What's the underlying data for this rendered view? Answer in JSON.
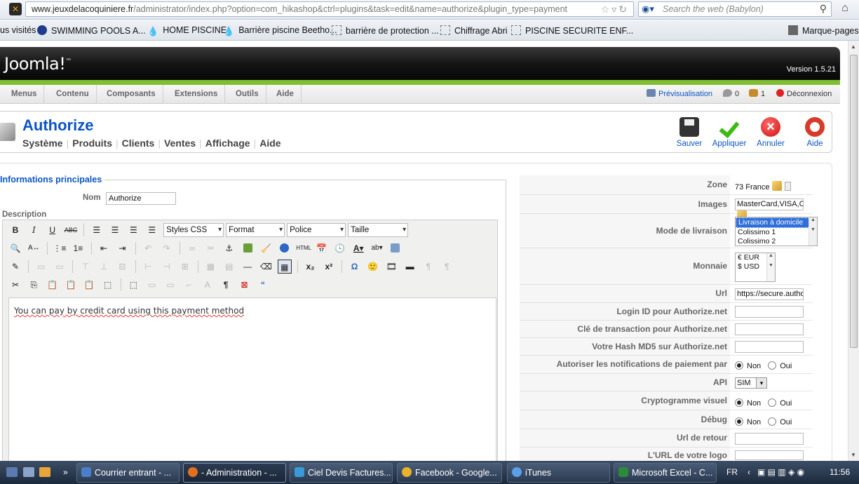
{
  "browser": {
    "url_domain": "www.jeuxdelacoquiniere.fr",
    "url_path": "/administrator/index.php?option=com_hikashop&ctrl=plugins&task=edit&name=authorize&plugin_type=payment",
    "search_placeholder": "Search the web (Babylon)",
    "bookmarks": [
      {
        "label": "us visités",
        "icon": "none"
      },
      {
        "label": "SWIMMING POOLS A...",
        "icon": "globe"
      },
      {
        "label": "HOME PISCINE",
        "icon": "drop"
      },
      {
        "label": "Barrière piscine Beetho...",
        "icon": "drop"
      },
      {
        "label": "barrière de protection ...",
        "icon": "empty"
      },
      {
        "label": "Chiffrage Abri",
        "icon": "empty"
      },
      {
        "label": "PISCINE SECURITE ENF...",
        "icon": "empty"
      }
    ],
    "bookmark_menu": "Marque-pages"
  },
  "joomla": {
    "logo": "Joomla!",
    "version": "Version 1.5.21",
    "menu": [
      "Menus",
      "Contenu",
      "Composants",
      "Extensions",
      "Outils",
      "Aide"
    ],
    "preview": "Prévisualisation",
    "messages_count": "0",
    "users_count": "1",
    "logout": "Déconnexion"
  },
  "page": {
    "title": "Authorize",
    "submenu": [
      "Système",
      "Produits",
      "Clients",
      "Ventes",
      "Affichage",
      "Aide"
    ],
    "toolbar": {
      "save": "Sauver",
      "apply": "Appliquer",
      "cancel": "Annuler",
      "help": "Aide"
    }
  },
  "main_info": {
    "legend": "Informations principales",
    "name_label": "Nom",
    "name_value": "Authorize",
    "description_label": "Description"
  },
  "editor": {
    "styles_css": "Styles CSS",
    "format": "Format",
    "font": "Police",
    "size": "Taille",
    "content": "You can pay by credit card using this payment method"
  },
  "params": {
    "zone_label": "Zone",
    "zone_value": "73 France",
    "images_label": "Images",
    "images_value": "MasterCard,VISA,Credit",
    "shipping_label": "Mode de livraison",
    "shipping_options": [
      "Livraison à domicile",
      "Colissimo 1",
      "Colissimo 2"
    ],
    "currency_label": "Monnaie",
    "currency_options": [
      "€ EUR",
      "$ USD"
    ],
    "url_label": "Url",
    "url_value": "https://secure.authorize",
    "login_label": "Login ID pour Authorize.net",
    "transaction_label": "Clé de transaction pour Authorize.net",
    "md5_label": "Votre Hash MD5 sur Authorize.net",
    "notif_label": "Autoriser les notifications de paiement par Authorize",
    "api_label": "API",
    "api_value": "SIM",
    "cvv_label": "Cryptogramme visuel",
    "debug_label": "Débug",
    "return_label": "Url de retour",
    "logo_label": "L'URL de votre logo",
    "no": "Non",
    "yes": "Oui"
  },
  "taskbar": {
    "tasks": [
      "Courrier entrant - ...",
      "- Administration - ...",
      "Ciel Devis Factures...",
      "Facebook - Google...",
      "iTunes",
      "Microsoft Excel - C..."
    ],
    "lang": "FR",
    "time": "11:56"
  }
}
